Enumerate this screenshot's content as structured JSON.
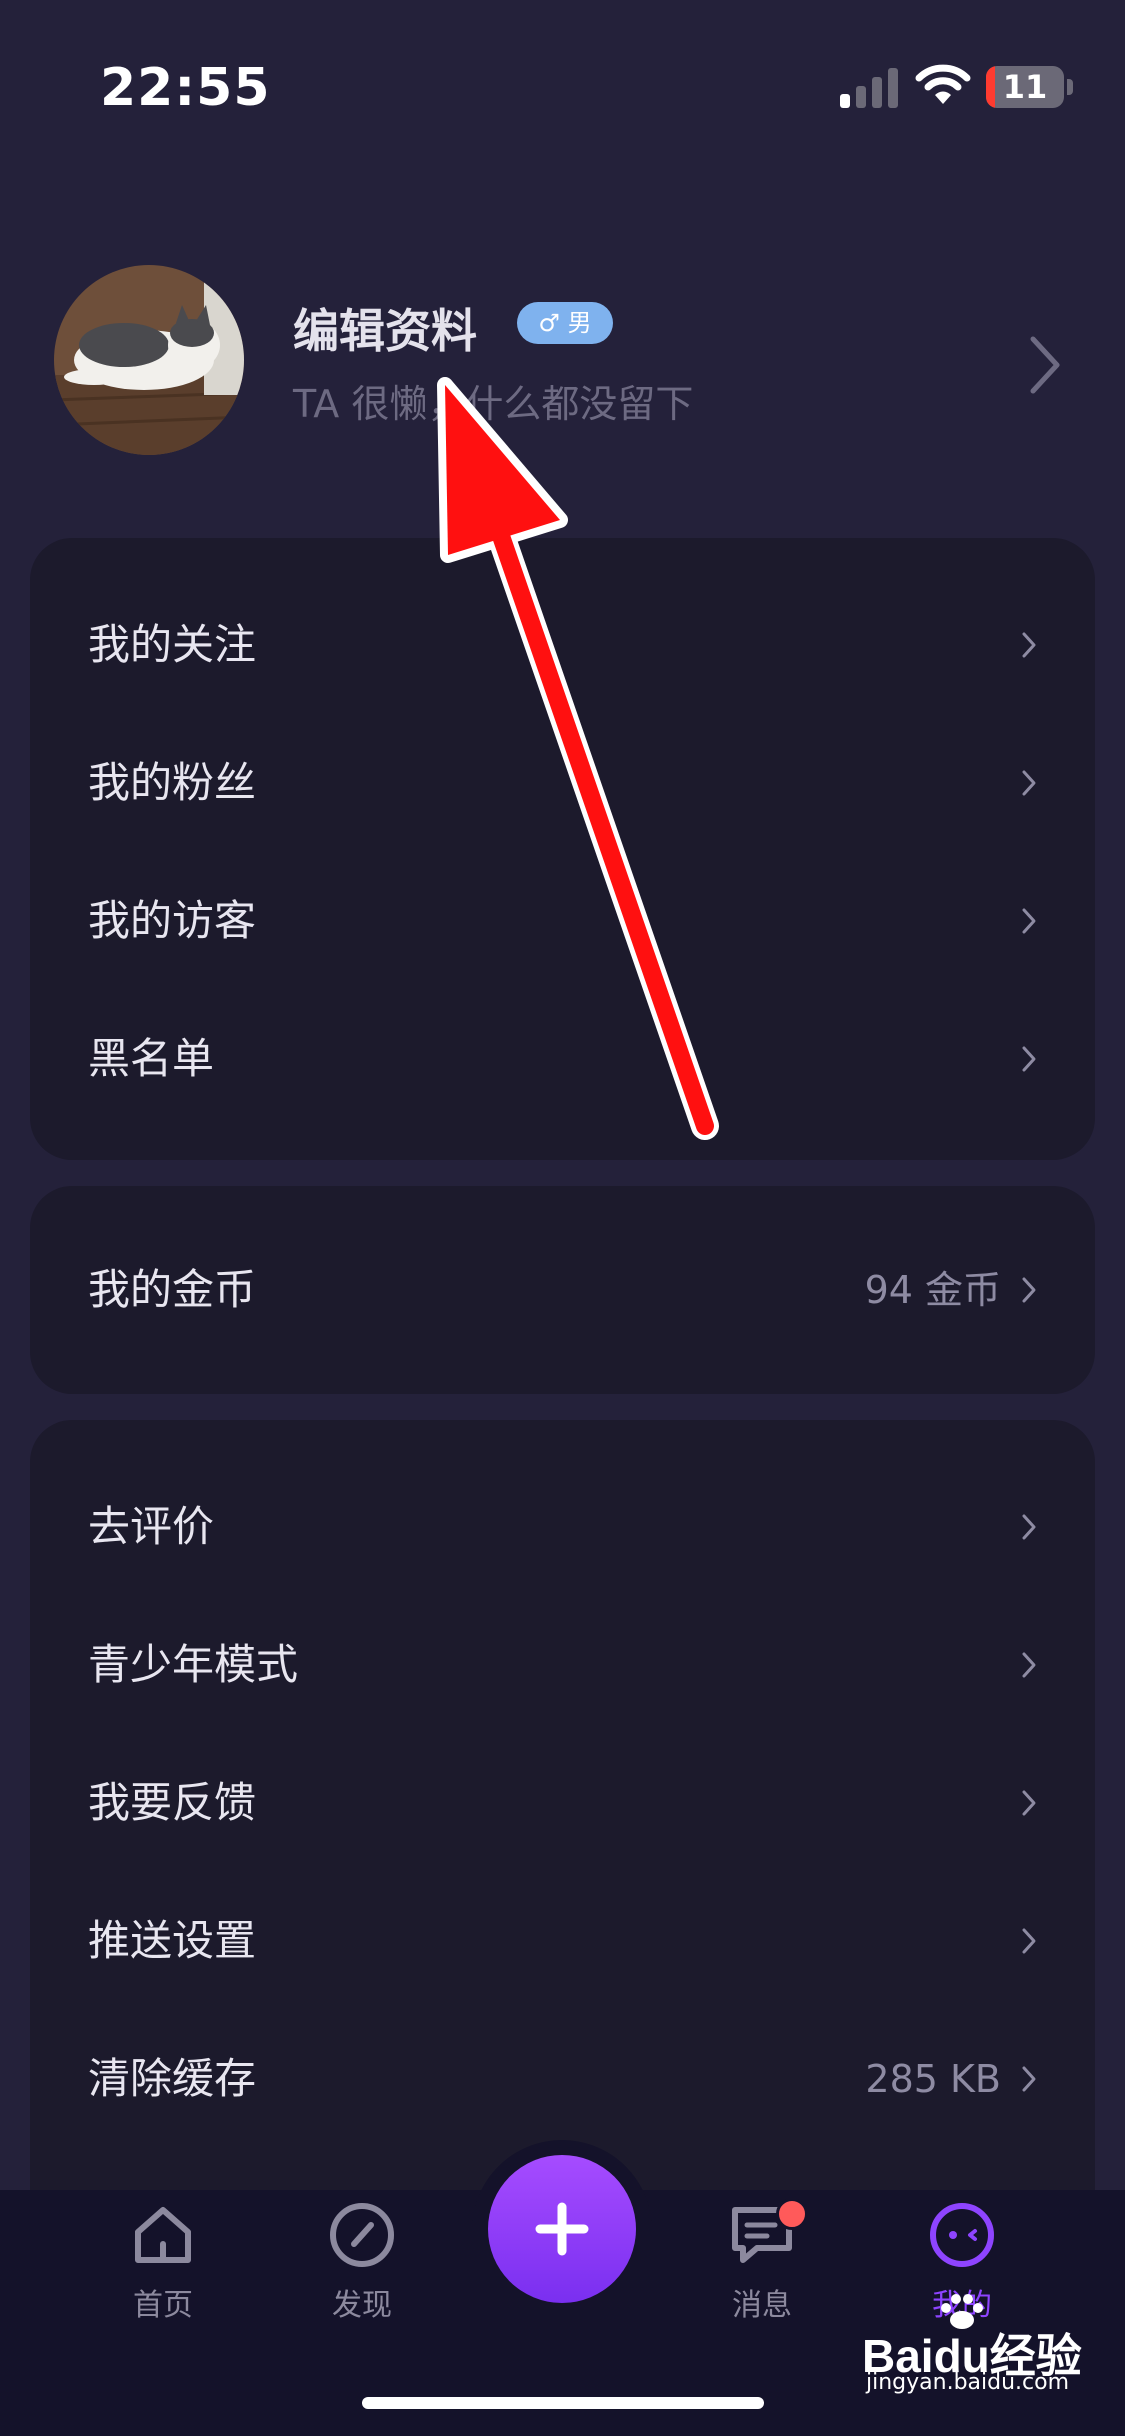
{
  "status_bar": {
    "time": "22:55",
    "battery": "11",
    "icons": [
      "cellular-signal-icon",
      "wifi-icon",
      "battery-icon"
    ]
  },
  "profile": {
    "name": "编辑资料",
    "gender_symbol": "♂",
    "gender_label": "男",
    "bio": "TA 很懒，什么都没留下",
    "avatar_icon": "cat-photo-avatar"
  },
  "social_menu": [
    {
      "label": "我的关注"
    },
    {
      "label": "我的粉丝"
    },
    {
      "label": "我的访客"
    },
    {
      "label": "黑名单"
    }
  ],
  "coins_menu": {
    "label": "我的金币",
    "value": "94 金币"
  },
  "settings_menu": [
    {
      "label": "去评价",
      "value": ""
    },
    {
      "label": "青少年模式",
      "value": ""
    },
    {
      "label": "我要反馈",
      "value": ""
    },
    {
      "label": "推送设置",
      "value": ""
    },
    {
      "label": "清除缓存",
      "value": "285 KB"
    }
  ],
  "tab_bar": {
    "tabs": [
      {
        "label": "首页",
        "icon": "home-icon"
      },
      {
        "label": "发现",
        "icon": "compass-icon"
      },
      {
        "label": "消息",
        "icon": "chat-icon"
      },
      {
        "label": "我的",
        "icon": "face-icon"
      }
    ],
    "active": "我的",
    "add_icon": "plus-icon"
  },
  "watermark": {
    "brand": "Baidu经验",
    "site": "jingyan.baidu.com"
  },
  "colors": {
    "background": "#24213a",
    "card": "#1c1a2c",
    "accent": "#8e44ff",
    "annotation_arrow": "#ff1010",
    "gender_badge": "#7fb2ee"
  }
}
